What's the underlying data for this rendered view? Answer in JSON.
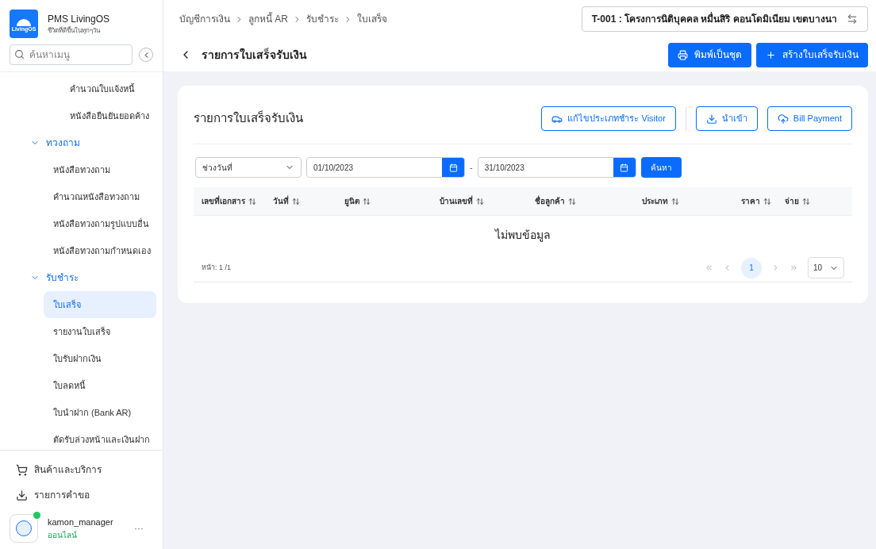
{
  "app": {
    "logo_text": "LivingOS",
    "name": "PMS LivingOS",
    "tagline": "ชีวิตที่ดีขึ้นในทุกๆวัน"
  },
  "sidebar": {
    "search": {
      "placeholder": "ค้นหาเมนู"
    },
    "items": [
      {
        "label": "คำนวณใบแจ้งหนี้",
        "kind": "sub",
        "selected": false
      },
      {
        "label": "หนังสือยืนยันยอดค้าง",
        "kind": "sub",
        "selected": false
      },
      {
        "label": "ทวงถาม",
        "kind": "group",
        "expanded": true,
        "children": [
          {
            "label": "หนังสือทวงถาม",
            "selected": false
          },
          {
            "label": "คำนวณหนังสือทวงถาม",
            "selected": false
          },
          {
            "label": "หนังสือทวงถามรูปแบบอื่น",
            "selected": false
          },
          {
            "label": "หนังสือทวงถามกำหนดเอง",
            "selected": false
          }
        ]
      },
      {
        "label": "รับชำระ",
        "kind": "group",
        "expanded": true,
        "children": [
          {
            "label": "ใบเสร็จ",
            "selected": true
          },
          {
            "label": "รายงานใบเสร็จ",
            "selected": false
          },
          {
            "label": "ใบรับฝากเงิน",
            "selected": false
          },
          {
            "label": "ใบลดหนี้",
            "selected": false
          },
          {
            "label": "ใบนำฝาก (Bank AR)",
            "selected": false
          },
          {
            "label": "ตัดรับล่วงหน้าและเงินฝาก",
            "selected": false
          }
        ]
      }
    ],
    "bottom_items": [
      {
        "label": "สินค้าและบริการ",
        "kind": "cart"
      },
      {
        "label": "รายการคำขอ",
        "kind": "download"
      }
    ],
    "user": {
      "name": "kamon_manager",
      "status": "ออนไลน์",
      "online": true,
      "menu": "···"
    }
  },
  "breadcrumb": [
    "บัญชีการเงิน",
    "ลูกหนี้ AR",
    "รับชำระ",
    "ใบเสร็จ"
  ],
  "project": "T-001 : โครงการนิติบุคคล หมื่นสิริ คอนโดมิเนียม เขตบางนา",
  "page_title": "รายการใบเสร็จรับเงิน",
  "header_buttons": [
    {
      "label": "พิมพ์เป็นชุด",
      "kind": "print"
    },
    {
      "label": "สร้างใบเสร็จรับเงิน",
      "kind": "plus"
    }
  ],
  "card": {
    "title": "รายการใบเสร็จรับเงิน",
    "actions": [
      {
        "label": "แก้ไขประเภทชำระ Visitor",
        "kind": "car"
      },
      {
        "label": "นำเข้า",
        "kind": "download"
      },
      {
        "label": "Bill Payment",
        "kind": "cloud"
      }
    ],
    "filter": {
      "range_type": "ช่วงวันที่",
      "date_from": "01/10/2023",
      "separator": "-",
      "date_to": "31/10/2023",
      "search_button": "ค้นหา"
    },
    "table": {
      "columns": [
        "เลขที่เอกสาร",
        "วันที่",
        "ยูนิต",
        "บ้านเลขที่",
        "ชื่อลูกค้า",
        "ประเภท",
        "ราคา",
        "จ่าย"
      ],
      "empty": "ไม่พบข้อมูล"
    },
    "pagination": {
      "info": "หน้า: 1 /1",
      "pages": [
        {
          "label": "1",
          "selected": true
        }
      ],
      "page_size": "10"
    }
  }
}
